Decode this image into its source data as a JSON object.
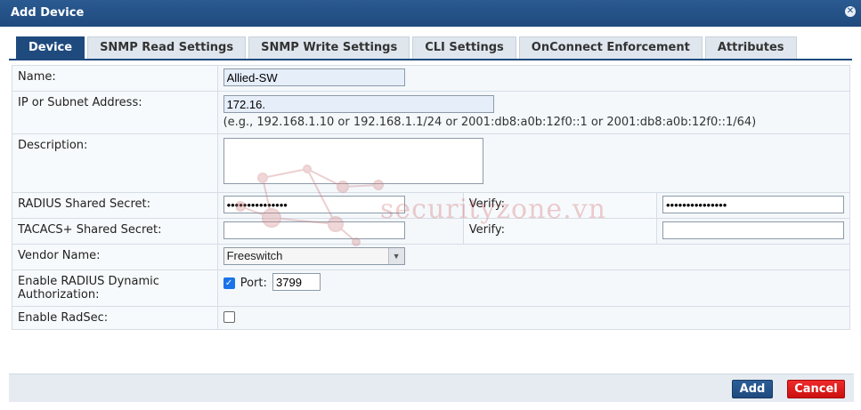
{
  "dialog": {
    "title": "Add Device"
  },
  "tabs": [
    {
      "label": "Device",
      "active": true
    },
    {
      "label": "SNMP Read Settings"
    },
    {
      "label": "SNMP Write Settings"
    },
    {
      "label": "CLI Settings"
    },
    {
      "label": "OnConnect Enforcement"
    },
    {
      "label": "Attributes"
    }
  ],
  "form": {
    "name": {
      "label": "Name:",
      "value": "Allied-SW"
    },
    "ip": {
      "label": "IP or Subnet Address:",
      "value": "172.16.",
      "hint": "(e.g., 192.168.1.10 or 192.168.1.1/24 or 2001:db8:a0b:12f0::1 or 2001:db8:a0b:12f0::1/64)"
    },
    "description": {
      "label": "Description:",
      "value": ""
    },
    "radius_secret": {
      "label": "RADIUS Shared Secret:",
      "value": "•••••••••••••••",
      "verify_label": "Verify:",
      "verify_value": "•••••••••••••••"
    },
    "tacacs_secret": {
      "label": "TACACS+ Shared Secret:",
      "value": "",
      "verify_label": "Verify:",
      "verify_value": ""
    },
    "vendor": {
      "label": "Vendor Name:",
      "value": "Freeswitch"
    },
    "radius_dyn_auth": {
      "label": "Enable RADIUS Dynamic Authorization:",
      "checked": true,
      "port_label": "Port:",
      "port_value": "3799"
    },
    "radsec": {
      "label": "Enable RadSec:",
      "checked": false
    }
  },
  "watermark": {
    "text": "securityzone.vn"
  },
  "footer": {
    "add_label": "Add",
    "cancel_label": "Cancel"
  },
  "colors": {
    "header": "#1f4a7e",
    "cancel": "#e01b1b",
    "checkbox": "#1a73e8"
  }
}
